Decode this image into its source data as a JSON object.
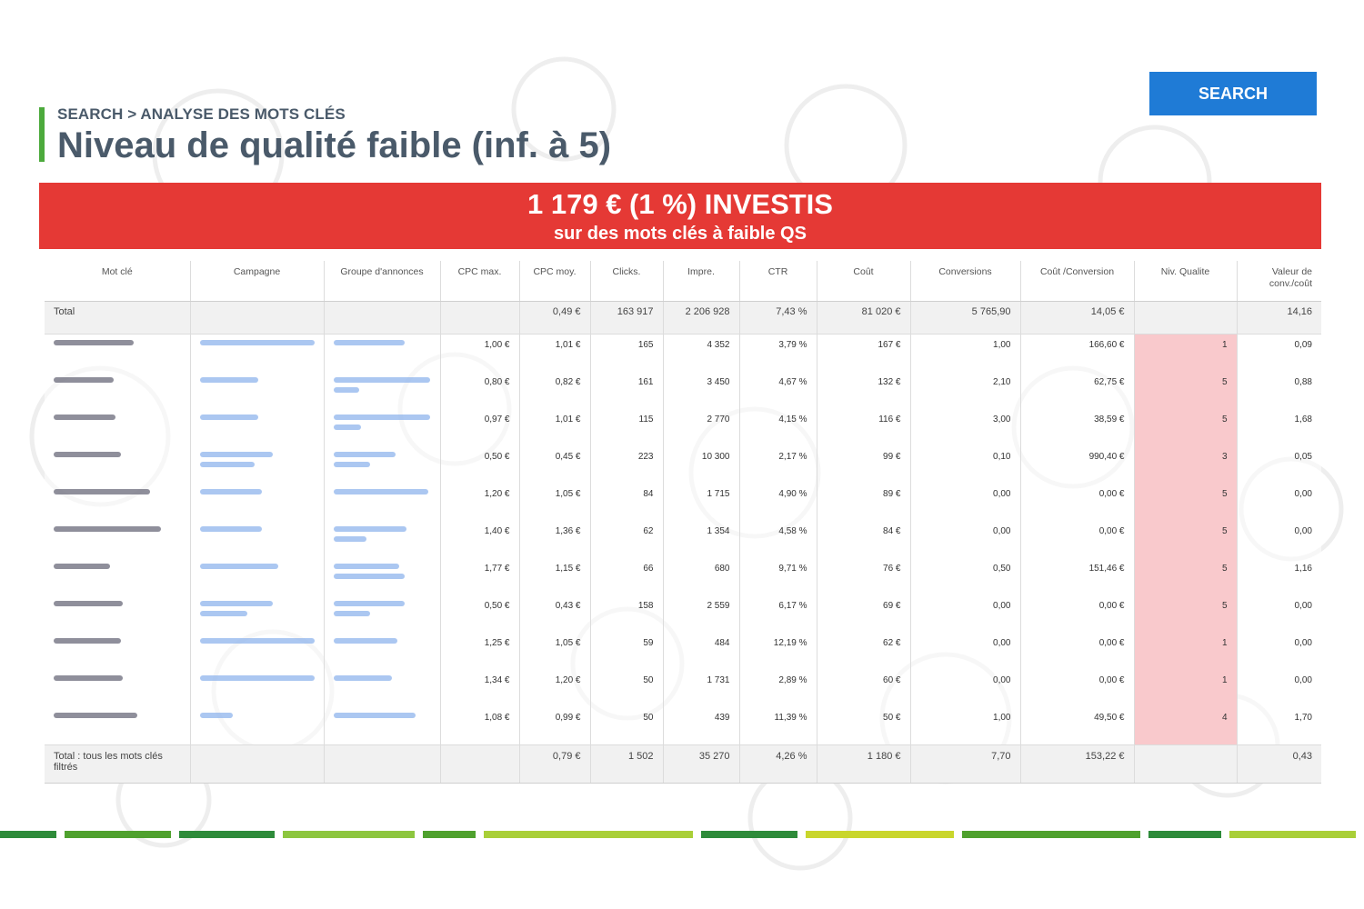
{
  "header": {
    "breadcrumb": "SEARCH > ANALYSE DES MOTS CLÉS",
    "title": "Niveau de qualité faible (inf. à 5)",
    "search_label": "SEARCH"
  },
  "banner": {
    "line1": "1 179 € (1 %) INVESTIS",
    "line2": "sur des mots clés à faible QS"
  },
  "colors": {
    "accent_green": "#4caa3c",
    "banner_red": "#e53935",
    "button_blue": "#1f7bd6",
    "qs_highlight": "#f9c9cc"
  },
  "table": {
    "columns": [
      "Mot clé",
      "Campagne",
      "Groupe d'annonces",
      "CPC max.",
      "CPC moy.",
      "Clicks.",
      "Impre.",
      "CTR",
      "Coût",
      "Conversions",
      "Coût /Conversion",
      "Niv. Qualite",
      "Valeur de conv./coût"
    ],
    "total": {
      "label": "Total",
      "cpc_moy": "0,49 €",
      "clicks": "163 917",
      "impre": "2 206 928",
      "ctr": "7,43 %",
      "cout": "81 020 €",
      "conversions": "5 765,90",
      "cout_conv": "14,05 €",
      "qs": "",
      "valeur": "14,16"
    },
    "rows": [
      {
        "cpc_max": "1,00 €",
        "cpc_moy": "1,01 €",
        "clicks": "165",
        "impre": "4 352",
        "ctr": "3,79 %",
        "cout": "167 €",
        "conversions": "1,00",
        "cout_conv": "166,60 €",
        "qs": "1",
        "valeur": "0,09"
      },
      {
        "cpc_max": "0,80 €",
        "cpc_moy": "0,82 €",
        "clicks": "161",
        "impre": "3 450",
        "ctr": "4,67 %",
        "cout": "132 €",
        "conversions": "2,10",
        "cout_conv": "62,75 €",
        "qs": "5",
        "valeur": "0,88"
      },
      {
        "cpc_max": "0,97 €",
        "cpc_moy": "1,01 €",
        "clicks": "115",
        "impre": "2 770",
        "ctr": "4,15 %",
        "cout": "116 €",
        "conversions": "3,00",
        "cout_conv": "38,59 €",
        "qs": "5",
        "valeur": "1,68"
      },
      {
        "cpc_max": "0,50 €",
        "cpc_moy": "0,45 €",
        "clicks": "223",
        "impre": "10 300",
        "ctr": "2,17 %",
        "cout": "99 €",
        "conversions": "0,10",
        "cout_conv": "990,40 €",
        "qs": "3",
        "valeur": "0,05"
      },
      {
        "cpc_max": "1,20 €",
        "cpc_moy": "1,05 €",
        "clicks": "84",
        "impre": "1 715",
        "ctr": "4,90 %",
        "cout": "89 €",
        "conversions": "0,00",
        "cout_conv": "0,00 €",
        "qs": "5",
        "valeur": "0,00"
      },
      {
        "cpc_max": "1,40 €",
        "cpc_moy": "1,36 €",
        "clicks": "62",
        "impre": "1 354",
        "ctr": "4,58 %",
        "cout": "84 €",
        "conversions": "0,00",
        "cout_conv": "0,00 €",
        "qs": "5",
        "valeur": "0,00"
      },
      {
        "cpc_max": "1,77 €",
        "cpc_moy": "1,15 €",
        "clicks": "66",
        "impre": "680",
        "ctr": "9,71 %",
        "cout": "76 €",
        "conversions": "0,50",
        "cout_conv": "151,46 €",
        "qs": "5",
        "valeur": "1,16"
      },
      {
        "cpc_max": "0,50 €",
        "cpc_moy": "0,43 €",
        "clicks": "158",
        "impre": "2 559",
        "ctr": "6,17 %",
        "cout": "69 €",
        "conversions": "0,00",
        "cout_conv": "0,00 €",
        "qs": "5",
        "valeur": "0,00"
      },
      {
        "cpc_max": "1,25 €",
        "cpc_moy": "1,05 €",
        "clicks": "59",
        "impre": "484",
        "ctr": "12,19 %",
        "cout": "62 €",
        "conversions": "0,00",
        "cout_conv": "0,00 €",
        "qs": "1",
        "valeur": "0,00"
      },
      {
        "cpc_max": "1,34 €",
        "cpc_moy": "1,20 €",
        "clicks": "50",
        "impre": "1 731",
        "ctr": "2,89 %",
        "cout": "60 €",
        "conversions": "0,00",
        "cout_conv": "0,00 €",
        "qs": "1",
        "valeur": "0,00"
      },
      {
        "cpc_max": "1,08 €",
        "cpc_moy": "0,99 €",
        "clicks": "50",
        "impre": "439",
        "ctr": "11,39 %",
        "cout": "50 €",
        "conversions": "1,00",
        "cout_conv": "49,50 €",
        "qs": "4",
        "valeur": "1,70"
      }
    ],
    "footer": {
      "label": "Total : tous les mots clés filtrés",
      "cpc_moy": "0,79 €",
      "clicks": "1 502",
      "impre": "35 270",
      "ctr": "4,26 %",
      "cout": "1 180 €",
      "conversions": "7,70",
      "cout_conv": "153,22 €",
      "valeur": "0,43"
    }
  }
}
